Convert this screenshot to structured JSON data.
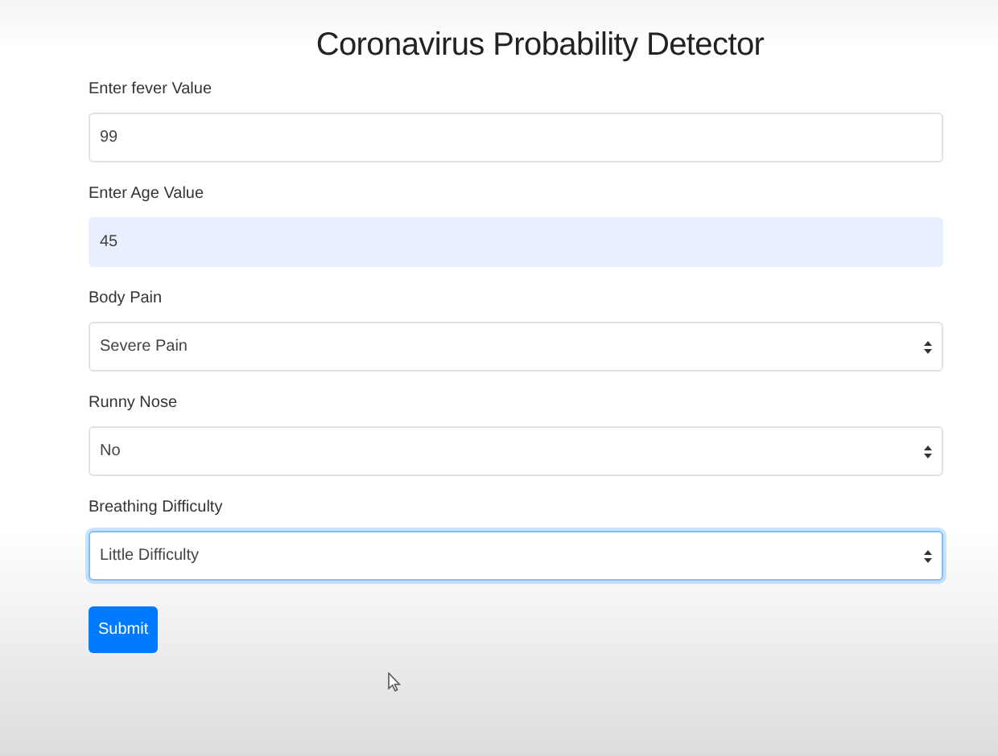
{
  "title": "Coronavirus Probability Detector",
  "fields": [
    {
      "kind": "input",
      "label": "Enter fever Value",
      "value": "99",
      "autofilled": false,
      "focused": false
    },
    {
      "kind": "input",
      "label": "Enter Age Value",
      "value": "45",
      "autofilled": true,
      "focused": false
    },
    {
      "kind": "select",
      "label": "Body Pain",
      "value": "Severe Pain",
      "autofilled": false,
      "focused": false
    },
    {
      "kind": "select",
      "label": "Runny Nose",
      "value": "No",
      "autofilled": false,
      "focused": false
    },
    {
      "kind": "select",
      "label": "Breathing Difficulty",
      "value": "Little Difficulty",
      "autofilled": false,
      "focused": true
    }
  ],
  "submit": "Submit"
}
